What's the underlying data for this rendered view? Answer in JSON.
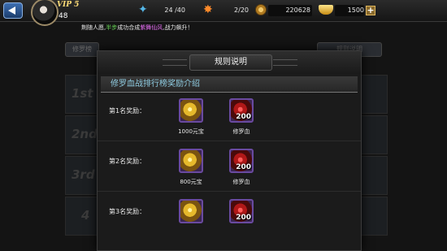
{
  "topbar": {
    "vip_label": "VIP 5",
    "level": "48",
    "stamina": "24 /40",
    "energy": "2/20",
    "coins": "220628",
    "ingots": "1500",
    "plus": "+"
  },
  "ticker": {
    "part1": "荆随人愿,",
    "part2": "半步",
    "part3": "成功合成",
    "part4": "紫舞仙风",
    "part5": ",战力飙升！"
  },
  "background": {
    "tab_left": "修罗榜",
    "tab_right": "规则说明",
    "ranks": [
      "1st",
      "2nd",
      "3rd",
      "4"
    ]
  },
  "modal": {
    "title": "规则说明",
    "section_title": "修罗血战排行榜奖励介绍",
    "rewards": [
      {
        "rank_label": "第1名奖励：",
        "gold_caption": "1000元宝",
        "blood_count": "200",
        "blood_caption": "修罗血"
      },
      {
        "rank_label": "第2名奖励：",
        "gold_caption": "800元宝",
        "blood_count": "200",
        "blood_caption": "修罗血"
      },
      {
        "rank_label": "第3名奖励：",
        "gold_caption": "",
        "blood_count": "200",
        "blood_caption": ""
      }
    ]
  }
}
